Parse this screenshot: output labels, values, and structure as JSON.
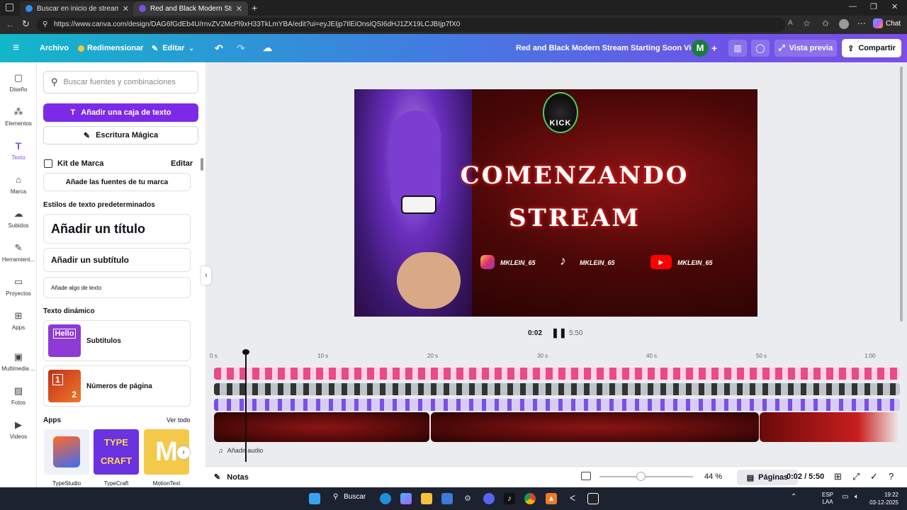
{
  "browser": {
    "tabs": [
      {
        "title": "Buscar en inicio de stream anima",
        "active": false
      },
      {
        "title": "Red and Black Modern Stream St",
        "active": true
      }
    ],
    "url": "https://www.canva.com/design/DAG6fGdEb4U/rnvZV2McPl9xH33TkLmYBA/edit?ui=eyJEIjp7IlEiOnsiQSI6dHJ1ZX19LCJBIjp7fX0",
    "chat_label": "Chat"
  },
  "header": {
    "archivo": "Archivo",
    "redimensionar": "Redimensionar",
    "editar": "Editar",
    "title": "Red and Black Modern Stream Starting Soon Video",
    "avatar_letter": "M",
    "vista_previa": "Vista previa",
    "compartir": "Compartir"
  },
  "rail": [
    {
      "label": "Diseño",
      "icon": "layout-icon"
    },
    {
      "label": "Elementos",
      "icon": "shapes-icon"
    },
    {
      "label": "Texto",
      "icon": "text-icon"
    },
    {
      "label": "Marca",
      "icon": "brand-icon"
    },
    {
      "label": "Subidos",
      "icon": "cloud-upload-icon"
    },
    {
      "label": "Herramient...",
      "icon": "pen-icon"
    },
    {
      "label": "Proyectos",
      "icon": "folder-icon"
    },
    {
      "label": "Apps",
      "icon": "apps-icon"
    },
    {
      "label": "Multimedia ...",
      "icon": "media-icon"
    },
    {
      "label": "Fotos",
      "icon": "photo-icon"
    },
    {
      "label": "Videos",
      "icon": "video-icon"
    }
  ],
  "panel": {
    "search_placeholder": "Buscar fuentes y combinaciones",
    "add_text_box": "Añadir una caja de texto",
    "magic_writing": "Escritura Mágica",
    "brand_kit": "Kit de Marca",
    "brand_edit": "Editar",
    "add_brand_fonts": "Añade las fuentes de tu marca",
    "default_styles": "Estilos de texto predeterminados",
    "add_title": "Añadir un título",
    "add_subtitle": "Añadir un subtítulo",
    "add_body": "Añade algo de texto",
    "dynamic_text": "Texto dinámico",
    "subtitles": "Subtítulos",
    "page_numbers": "Números de página",
    "hello_tile": "Hello",
    "page_tile_1": "1",
    "page_tile_2": "2",
    "apps": "Apps",
    "see_all": "Ver todo",
    "apps_list": [
      "TypeStudio",
      "TypeCraft",
      "MotionText"
    ]
  },
  "design": {
    "logo_text": "KICK",
    "headline_1": "COMENZANDO",
    "headline_2": "STREAM",
    "handle_1": "MKLEIN_65",
    "handle_2": "MKLEIN_65",
    "handle_3": "MKLEIN_65"
  },
  "playback": {
    "current": "0:02",
    "total": "5:50"
  },
  "timeline": {
    "ticks": [
      "0 s",
      "10 s",
      "20 s",
      "30 s",
      "40 s",
      "50 s",
      "1:00"
    ],
    "add_audio": "Añadir audio"
  },
  "status": {
    "notes": "Notas",
    "zoom": "44 %",
    "zoom_level": 0.44,
    "pages": "Páginas",
    "time": "0:02 / 5:50"
  },
  "taskbar": {
    "search": "Buscar",
    "lang1": "ESP",
    "lang2": "LAA",
    "clock": "19:22",
    "date": "03-12-2025"
  }
}
